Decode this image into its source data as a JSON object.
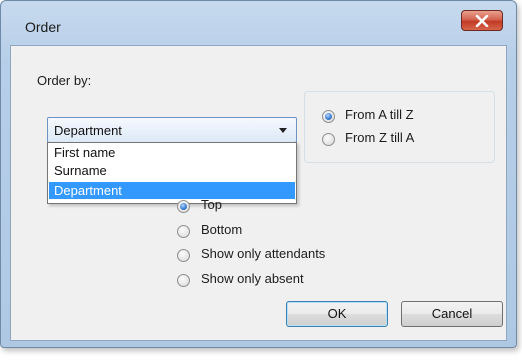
{
  "window": {
    "title": "Order",
    "close_icon": "close-x-icon"
  },
  "order_by": {
    "label": "Order by:",
    "selected": "Department",
    "options": [
      "First name",
      "Surname",
      "Department"
    ]
  },
  "sort_direction": {
    "options": [
      "From A till Z",
      "From Z till A"
    ],
    "selected_index": 0
  },
  "position": {
    "options": [
      "Top",
      "Bottom",
      "Show only attendants",
      "Show only absent"
    ],
    "selected_index": 0
  },
  "buttons": {
    "ok": "OK",
    "cancel": "Cancel"
  },
  "colors": {
    "close_button": "#c23a24",
    "selection": "#3399ff",
    "radio_dot": "#3c7fd3"
  }
}
